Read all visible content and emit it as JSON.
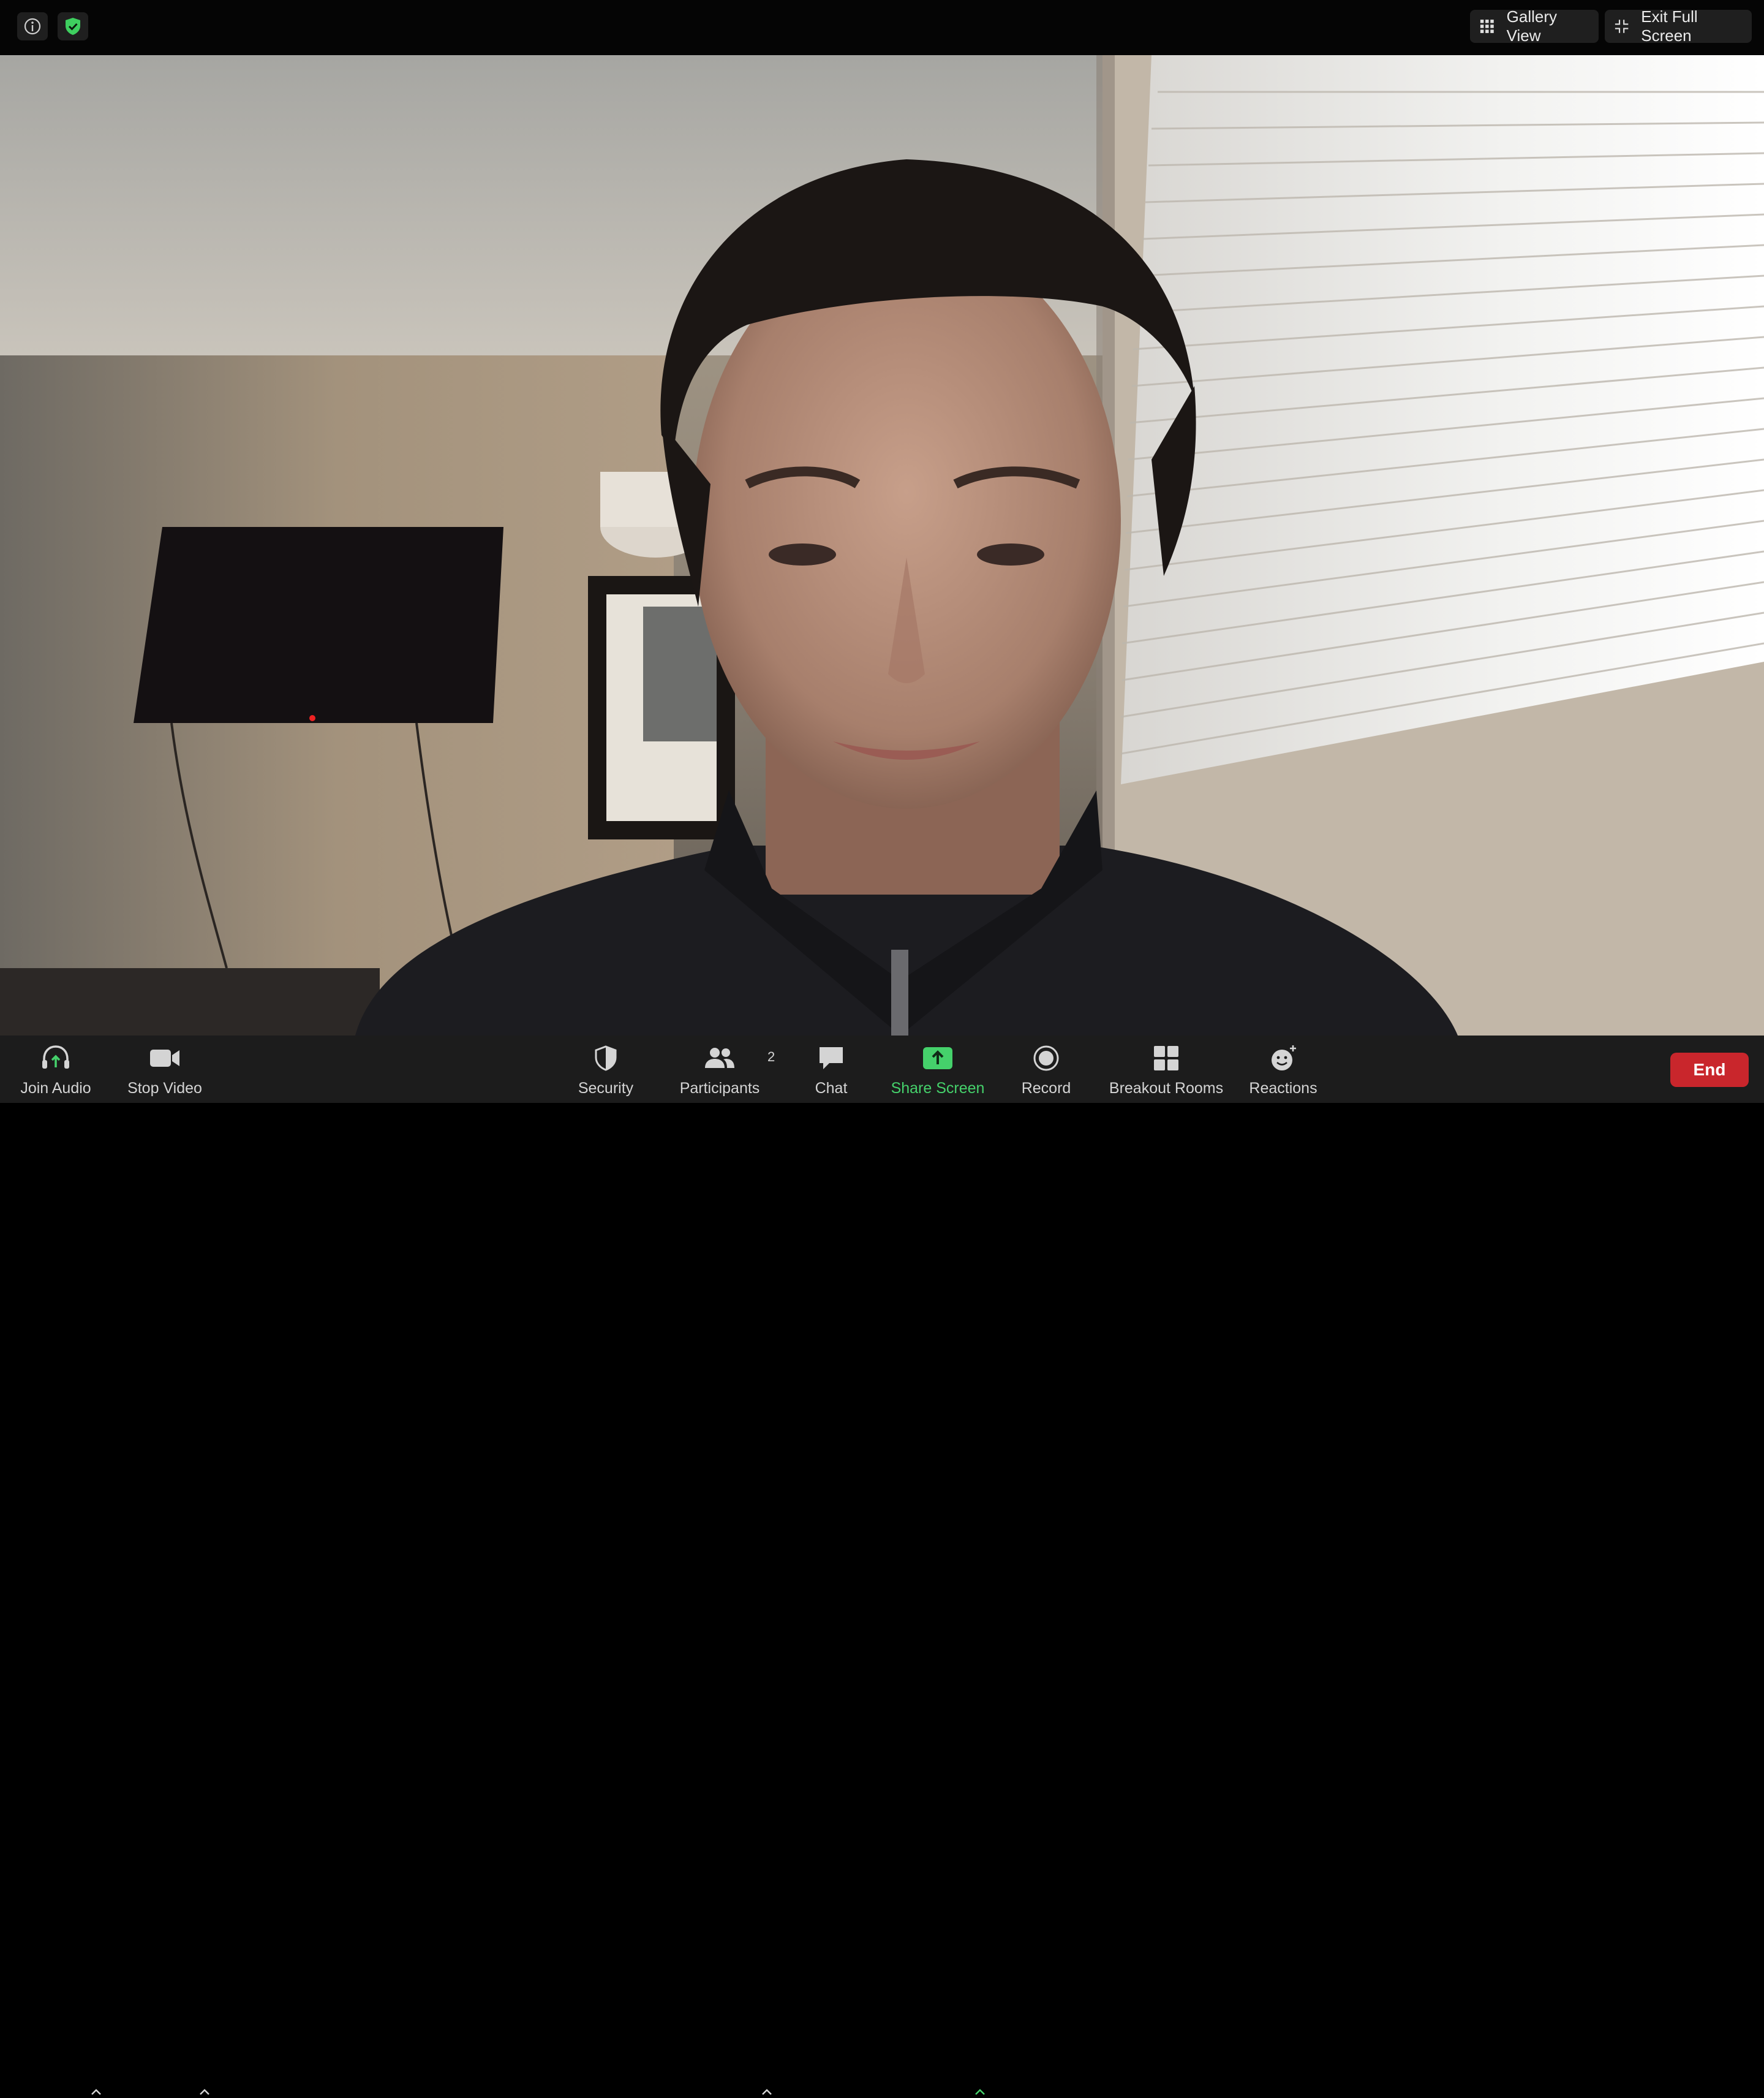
{
  "topbar": {
    "info_icon": "info-icon",
    "security_icon": "shield-check-icon",
    "gallery_view_label": "Gallery View",
    "exit_fullscreen_label": "Exit Full Screen"
  },
  "toolbar": {
    "join_audio_label": "Join Audio",
    "stop_video_label": "Stop Video",
    "security_label": "Security",
    "participants_label": "Participants",
    "participants_count": "2",
    "chat_label": "Chat",
    "share_screen_label": "Share Screen",
    "record_label": "Record",
    "breakout_rooms_label": "Breakout Rooms",
    "reactions_label": "Reactions",
    "end_label": "End"
  },
  "colors": {
    "share_green": "#45d16b",
    "end_red": "#c9262c",
    "toolbar_bg": "#1c1c1c"
  }
}
